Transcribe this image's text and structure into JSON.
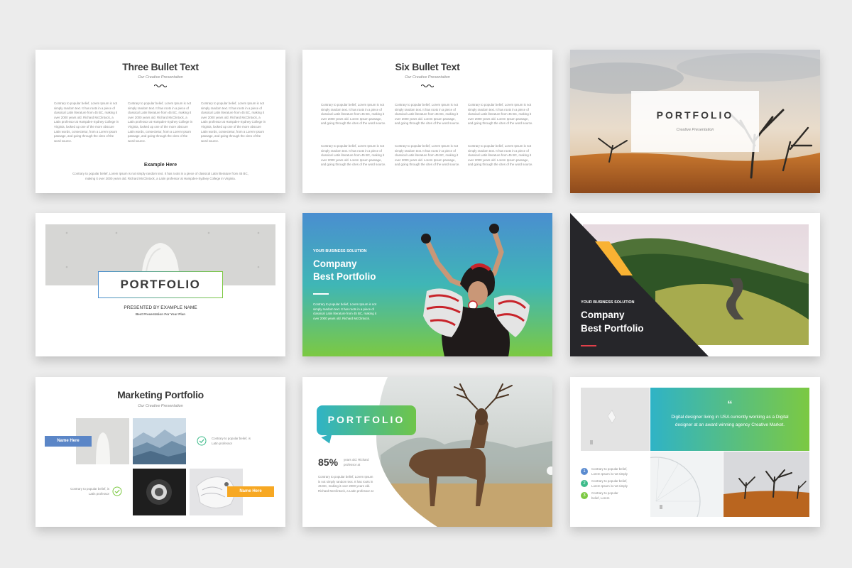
{
  "slides": {
    "three_bullet": {
      "title": "Three Bullet Text",
      "subtitle": "Our Creative Presentation",
      "col1": "Contrary to popular belief, Lorem Ipsum is not simply random text. It has roots in a piece of classical Latin literature from 45 BC, making it over 2000 years old. Richard McClintock, a Latin professor at Hampden-Sydney College in Virginia, looked up one of the more obscure Latin words, consectetur, from a Lorem Ipsum passage, and going through the cites of the word source.",
      "col2": "Contrary to popular belief, Lorem Ipsum is not simply random text. It has roots in a piece of classical Latin literature from 45 BC, making it over 2000 years old. Richard McClintock, a Latin professor at Hampden-Sydney College in Virginia, looked up one of the more obscure Latin words, consectetur, from a Lorem Ipsum passage, and going through the cites of the word source.",
      "col3": "Contrary to popular belief, Lorem Ipsum is not simply random text. It has roots in a piece of classical Latin literature from 45 BC, making it over 2000 years old. Richard McClintock, a Latin professor at Hampden-Sydney College in Virginia, looked up one of the more obscure Latin words, consectetur, from a Lorem Ipsum passage, and going through the cites of the word source.",
      "example_heading": "Example Here",
      "example_text": "Contrary to popular belief, Lorem Ipsum is not simply random text. It has roots in a piece of classical Latin literature from 45 BC, making it over 2000 years old. Richard McClintock, a Latin professor at Hampden-Sydney College in Virginia."
    },
    "six_bullet": {
      "title": "Six Bullet Text",
      "subtitle": "Our Creative Presentation",
      "blocks": [
        "Contrary to popular belief, Lorem Ipsum is not simply random text. It has roots in a piece of classical Latin literature from 45 BC, making it over 2000 years old. Lorem Ipsum passage, and going through the cites of the word source.",
        "Contrary to popular belief, Lorem Ipsum is not simply random text. It has roots in a piece of classical Latin literature from 45 BC, making it over 2000 years old. Lorem Ipsum passage, and going through the cites of the word source.",
        "Contrary to popular belief, Lorem Ipsum is not simply random text. It has roots in a piece of classical Latin literature from 45 BC, making it over 2000 years old. Lorem Ipsum passage, and going through the cites of the word source.",
        "Contrary to popular belief, Lorem Ipsum is not simply random text. It has roots in a piece of classical Latin literature from 45 BC, making it over 2000 years old. Lorem Ipsum passage, and going through the cites of the word source.",
        "Contrary to popular belief, Lorem Ipsum is not simply random text. It has roots in a piece of classical Latin literature from 45 BC, making it over 2000 years old. Lorem Ipsum passage, and going through the cites of the word source.",
        "Contrary to popular belief, Lorem Ipsum is not simply random text. It has roots in a piece of classical Latin literature from 45 BC, making it over 2000 years old. Lorem Ipsum passage, and going through the cites of the word source."
      ]
    },
    "portfolio_trees": {
      "title": "PORTFOLIO",
      "subtitle": "Creative Presentation"
    },
    "portfolio_chair": {
      "title": "PORTFOLIO",
      "presented_by": "PRESENTED BY EXAMPLE NAME",
      "tagline": "Best Presentation For Your Plan"
    },
    "company_dancer": {
      "kicker": "YOUR BUSINESS SOLUTION",
      "title_line1": "Company",
      "title_line2": "Best Portfolio",
      "body": "Contrary to popular belief, Lorem Ipsum is not simply random text. It has roots in a piece of classical Latin literature from 45 BC, making it over 2000 years old. Richard McClintock."
    },
    "company_road": {
      "kicker": "YOUR BUSINESS SOLUTION",
      "title_line1": "Company",
      "title_line2": "Best Portfolio"
    },
    "marketing": {
      "title": "Marketing Portfolio",
      "subtitle": "Our Creative Presentation",
      "tag1": "Name Here",
      "tag2": "Name Here",
      "note1": "Contrary to popular belief, is Latin professor",
      "note2": "Contrary to popular belief, is Latin professor"
    },
    "deer": {
      "title": "PORTFOLIO",
      "stat": "85%",
      "stat_note": "years old. Richard professor at",
      "body": "Contrary to popular belief, Lorem Ipsum is not simply random text. It has roots in 45 BC, making it over 2000 years old. Richard McClintock, a Latin professor at"
    },
    "quote": {
      "quote_mark": "“",
      "quote_text": "Digital designer living in USA currently working as a Digital designer at an award winning agency Creative Market.",
      "items": [
        {
          "num": "1",
          "text": "Contrary to popular belief, Lorem Ipsum is not simply"
        },
        {
          "num": "2",
          "text": "Contrary to popular belief, Lorem Ipsum is not simply"
        },
        {
          "num": "3",
          "text": "Contrary to popular belief, Lorem"
        }
      ]
    }
  },
  "colors": {
    "background": "#ececec",
    "dark_text": "#3a3a3a",
    "blue_tag": "#5b86c7",
    "orange_tag": "#f7a823",
    "gradient_top": "#4a8ed0",
    "gradient_bottom": "#7cc942",
    "teal": "#2fb3c6",
    "green": "#6fc54a",
    "accent_red": "#e0404a",
    "dark_panel": "#26262a",
    "yellow": "#f9b233",
    "num_blue": "#5a8bd0",
    "num_green": "#3dbb8a",
    "num_lime": "#7cc942"
  }
}
